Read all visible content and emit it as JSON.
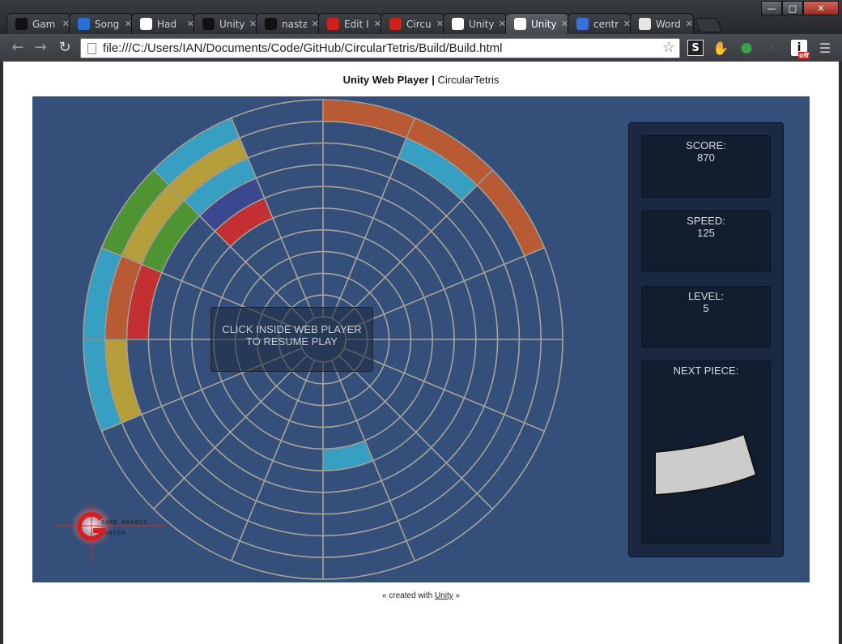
{
  "browser": {
    "tabs": [
      {
        "label": "Gam",
        "icon": "github-icon",
        "color": "#111111"
      },
      {
        "label": "Song",
        "icon": "s-icon",
        "color": "#2a6fd6"
      },
      {
        "label": "Had",
        "icon": "reddit-icon",
        "color": "#ffffff"
      },
      {
        "label": "Unity",
        "icon": "unity-icon",
        "color": "#111111"
      },
      {
        "label": "nasta",
        "icon": "github-icon",
        "color": "#111111"
      },
      {
        "label": "Edit I",
        "icon": "g-red-icon",
        "color": "#d0201a"
      },
      {
        "label": "Circu",
        "icon": "g-red-icon",
        "color": "#d0201a"
      },
      {
        "label": "Unity",
        "icon": "unity-icon",
        "color": "#ffffff"
      },
      {
        "label": "Unity",
        "icon": "page-icon",
        "color": "#ffffff",
        "active": true
      },
      {
        "label": "centr",
        "icon": "google-icon",
        "color": "#3b6fd8"
      },
      {
        "label": "Word",
        "icon": "wordpress-icon",
        "color": "#e5e5e5"
      }
    ],
    "url": "file:///C:/Users/IAN/Documents/Code/GitHub/CircularTetris/Build/Build.html",
    "ext_badge": "off"
  },
  "page": {
    "title_bold": "Unity Web Player",
    "title_sep": " | ",
    "title_rest": "CircularTetris",
    "footer_pre": "« created with ",
    "footer_link": "Unity",
    "footer_post": " »"
  },
  "game": {
    "overlay_line1": "CLICK INSIDE WEB PLAYER",
    "overlay_line2": "TO RESUME PLAY",
    "score_label": "SCORE:",
    "score": "870",
    "speed_label": "SPEED:",
    "speed": "125",
    "level_label": "LEVEL:",
    "level": "5",
    "next_label": "NEXT PIECE:",
    "logo_text_top": "GAME MAKERS",
    "logo_text_bottom": "UNION",
    "colors": {
      "background": "#34507a",
      "grid": "#a8a39a",
      "orange": "#b85a34",
      "cyan": "#37a0c2",
      "yellow": "#b69f3a",
      "green": "#4f9433",
      "red": "#c43032",
      "navy": "#3b4890",
      "next_piece": "#cccccc"
    },
    "rings": 10,
    "sectors": 16,
    "blocks": [
      {
        "ring": 9,
        "sector": 0,
        "color": "orange"
      },
      {
        "ring": 9,
        "sector": 1,
        "color": "orange"
      },
      {
        "ring": 8,
        "sector": 1,
        "color": "cyan"
      },
      {
        "ring": 9,
        "sector": 2,
        "color": "orange"
      },
      {
        "ring": 9,
        "sector": 14,
        "color": "cyan"
      },
      {
        "ring": 8,
        "sector": 14,
        "color": "yellow"
      },
      {
        "ring": 7,
        "sector": 14,
        "color": "cyan"
      },
      {
        "ring": 6,
        "sector": 14,
        "color": "navy"
      },
      {
        "ring": 5,
        "sector": 14,
        "color": "red"
      },
      {
        "ring": 9,
        "sector": 13,
        "color": "green"
      },
      {
        "ring": 8,
        "sector": 13,
        "color": "yellow"
      },
      {
        "ring": 7,
        "sector": 13,
        "color": "green"
      },
      {
        "ring": 9,
        "sector": 12,
        "color": "cyan"
      },
      {
        "ring": 8,
        "sector": 12,
        "color": "orange"
      },
      {
        "ring": 7,
        "sector": 12,
        "color": "red"
      },
      {
        "ring": 9,
        "sector": 11,
        "color": "cyan"
      },
      {
        "ring": 8,
        "sector": 11,
        "color": "yellow"
      },
      {
        "ring": 4,
        "sector": 7,
        "color": "cyan"
      }
    ]
  }
}
